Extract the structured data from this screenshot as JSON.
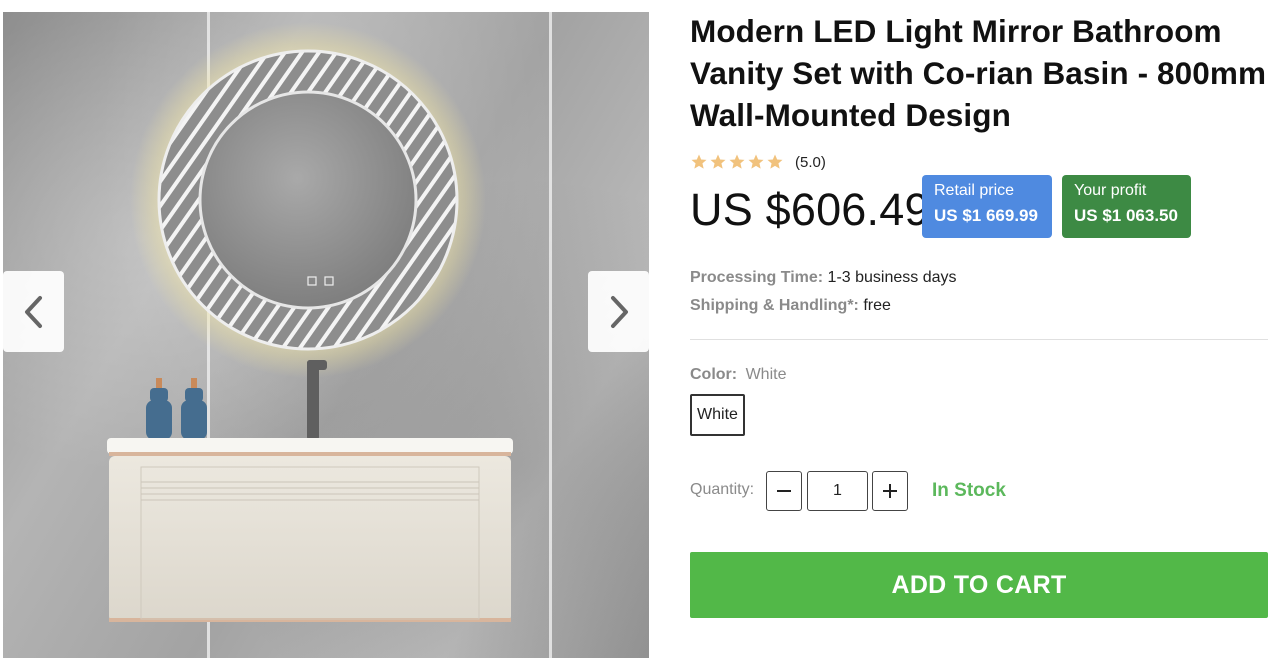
{
  "product": {
    "title": "Modern LED Light Mirror Bathroom Vanity Set with Co-rian Basin - 800mm Wall-Mounted Design",
    "rating": {
      "stars": 5,
      "value_text": "(5.0)",
      "star_color": "#f1c27d"
    },
    "price": "US $606.49",
    "retail": {
      "label": "Retail price",
      "value": "US $1 669.99",
      "color": "#4f8ae0"
    },
    "profit": {
      "label": "Your profit",
      "value": "US $1 063.50",
      "color": "#3d8a44"
    },
    "processing": {
      "label": "Processing Time:",
      "value": "1-3 business days"
    },
    "shipping": {
      "label": "Shipping & Handling*:",
      "value": "free"
    },
    "color": {
      "label": "Color:",
      "value": "White",
      "options": [
        "White"
      ]
    },
    "quantity": {
      "label": "Quantity:",
      "value": "1",
      "minus_icon": "minus-icon",
      "plus_icon": "plus-icon"
    },
    "stock": {
      "text": "In Stock",
      "color": "#5cb85c"
    },
    "cta": {
      "label": "ADD TO CART",
      "color": "#52b848"
    }
  },
  "gallery": {
    "prev_icon": "chevron-left-icon",
    "next_icon": "chevron-right-icon"
  }
}
